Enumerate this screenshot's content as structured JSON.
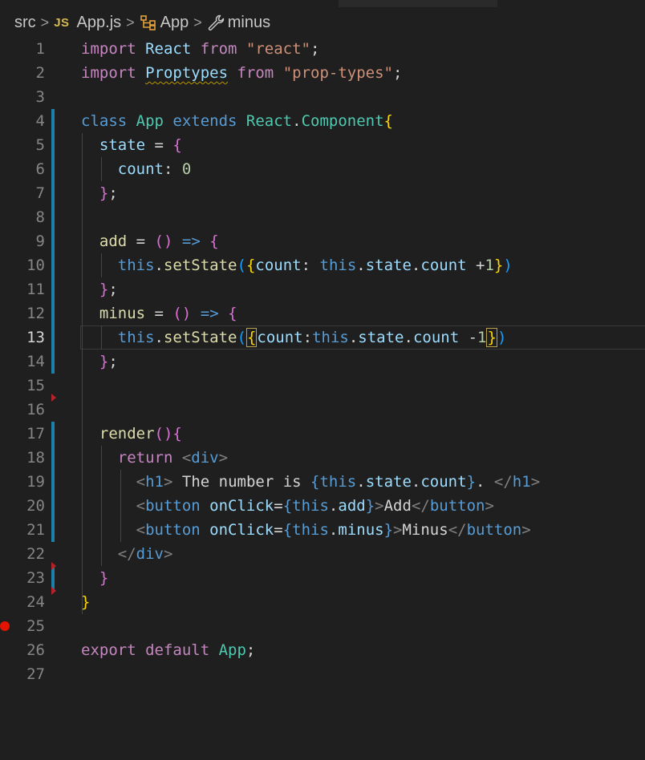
{
  "breadcrumb": {
    "folder": "src",
    "file_icon": "JS",
    "file": "App.js",
    "class_name": "App",
    "method_name": "minus"
  },
  "editor": {
    "active_line": 13,
    "line_numbers": [
      "1",
      "2",
      "3",
      "4",
      "5",
      "6",
      "7",
      "8",
      "9",
      "10",
      "11",
      "12",
      "13",
      "14",
      "15",
      "16",
      "17",
      "18",
      "19",
      "20",
      "21",
      "22",
      "23",
      "24",
      "25",
      "26",
      "27"
    ],
    "lines": [
      [
        [
          "kw",
          "import "
        ],
        [
          "var",
          "React "
        ],
        [
          "kw",
          "from "
        ],
        [
          "str",
          "\"react\""
        ],
        [
          "punc",
          ";"
        ]
      ],
      [
        [
          "kw",
          "import "
        ],
        [
          "var squiggle",
          "Proptypes"
        ],
        [
          "punc",
          " "
        ],
        [
          "kw",
          "from "
        ],
        [
          "str",
          "\"prop-types\""
        ],
        [
          "punc",
          ";"
        ]
      ],
      [],
      [
        [
          "kw2",
          "class "
        ],
        [
          "cls",
          "App "
        ],
        [
          "kw2",
          "extends "
        ],
        [
          "cls",
          "React"
        ],
        [
          "punc",
          "."
        ],
        [
          "cls",
          "Component"
        ],
        [
          "b1",
          "{"
        ]
      ],
      [
        [
          "punc",
          "  "
        ],
        [
          "var",
          "state "
        ],
        [
          "punc",
          "= "
        ],
        [
          "b2",
          "{"
        ]
      ],
      [
        [
          "punc",
          "    "
        ],
        [
          "var",
          "count"
        ],
        [
          "punc",
          ": "
        ],
        [
          "num",
          "0"
        ]
      ],
      [
        [
          "punc",
          "  "
        ],
        [
          "b2",
          "}"
        ],
        [
          "punc",
          ";"
        ]
      ],
      [],
      [
        [
          "punc",
          "  "
        ],
        [
          "fn",
          "add "
        ],
        [
          "punc",
          "= "
        ],
        [
          "b2",
          "()"
        ],
        [
          "punc",
          " "
        ],
        [
          "kw2",
          "=>"
        ],
        [
          "punc",
          " "
        ],
        [
          "b2",
          "{"
        ]
      ],
      [
        [
          "punc",
          "    "
        ],
        [
          "kw2",
          "this"
        ],
        [
          "punc",
          "."
        ],
        [
          "fn",
          "setState"
        ],
        [
          "b3",
          "("
        ],
        [
          "b1",
          "{"
        ],
        [
          "var",
          "count"
        ],
        [
          "punc",
          ": "
        ],
        [
          "kw2",
          "this"
        ],
        [
          "punc",
          "."
        ],
        [
          "var",
          "state"
        ],
        [
          "punc",
          "."
        ],
        [
          "var",
          "count "
        ],
        [
          "punc",
          "+"
        ],
        [
          "num",
          "1"
        ],
        [
          "b1",
          "}"
        ],
        [
          "b3",
          ")"
        ]
      ],
      [
        [
          "punc",
          "  "
        ],
        [
          "b2",
          "}"
        ],
        [
          "punc",
          ";"
        ]
      ],
      [
        [
          "punc",
          "  "
        ],
        [
          "fn",
          "minus "
        ],
        [
          "punc",
          "= "
        ],
        [
          "b2",
          "()"
        ],
        [
          "punc",
          " "
        ],
        [
          "kw2",
          "=>"
        ],
        [
          "punc",
          " "
        ],
        [
          "b2",
          "{"
        ]
      ],
      [
        [
          "punc",
          "    "
        ],
        [
          "kw2",
          "this"
        ],
        [
          "punc",
          "."
        ],
        [
          "fn",
          "setState"
        ],
        [
          "b3",
          "("
        ],
        [
          "b1 bracket-box",
          "{"
        ],
        [
          "var",
          "count"
        ],
        [
          "punc",
          ":"
        ],
        [
          "kw2",
          "this"
        ],
        [
          "punc",
          "."
        ],
        [
          "var",
          "state"
        ],
        [
          "punc",
          "."
        ],
        [
          "var",
          "count "
        ],
        [
          "punc",
          "-"
        ],
        [
          "num",
          "1"
        ],
        [
          "b1 bracket-box",
          "}"
        ],
        [
          "b3",
          ")"
        ]
      ],
      [
        [
          "punc",
          "  "
        ],
        [
          "b2",
          "}"
        ],
        [
          "punc",
          ";"
        ]
      ],
      [],
      [],
      [
        [
          "punc",
          "  "
        ],
        [
          "fn",
          "render"
        ],
        [
          "b2",
          "()"
        ],
        [
          "b2",
          "{"
        ]
      ],
      [
        [
          "punc",
          "    "
        ],
        [
          "kw",
          "return "
        ],
        [
          "tagp",
          "<"
        ],
        [
          "tag",
          "div"
        ],
        [
          "tagp",
          ">"
        ]
      ],
      [
        [
          "punc",
          "      "
        ],
        [
          "tagp",
          "<"
        ],
        [
          "tag",
          "h1"
        ],
        [
          "tagp",
          "> "
        ],
        [
          "txt",
          "The number is "
        ],
        [
          "kw2",
          "{"
        ],
        [
          "kw2",
          "this"
        ],
        [
          "punc",
          "."
        ],
        [
          "var",
          "state"
        ],
        [
          "punc",
          "."
        ],
        [
          "var",
          "count"
        ],
        [
          "kw2",
          "}"
        ],
        [
          "txt",
          ". "
        ],
        [
          "tagp",
          "</"
        ],
        [
          "tag",
          "h1"
        ],
        [
          "tagp",
          ">"
        ]
      ],
      [
        [
          "punc",
          "      "
        ],
        [
          "tagp",
          "<"
        ],
        [
          "tag",
          "button "
        ],
        [
          "attr",
          "onClick"
        ],
        [
          "punc",
          "="
        ],
        [
          "kw2",
          "{"
        ],
        [
          "kw2",
          "this"
        ],
        [
          "punc",
          "."
        ],
        [
          "var",
          "add"
        ],
        [
          "kw2",
          "}"
        ],
        [
          "tagp",
          ">"
        ],
        [
          "txt",
          "Add"
        ],
        [
          "tagp",
          "</"
        ],
        [
          "tag",
          "button"
        ],
        [
          "tagp",
          ">"
        ]
      ],
      [
        [
          "punc",
          "      "
        ],
        [
          "tagp",
          "<"
        ],
        [
          "tag",
          "button "
        ],
        [
          "attr",
          "onClick"
        ],
        [
          "punc",
          "="
        ],
        [
          "kw2",
          "{"
        ],
        [
          "kw2",
          "this"
        ],
        [
          "punc",
          "."
        ],
        [
          "var",
          "minus"
        ],
        [
          "kw2",
          "}"
        ],
        [
          "tagp",
          ">"
        ],
        [
          "txt",
          "Minus"
        ],
        [
          "tagp",
          "</"
        ],
        [
          "tag",
          "button"
        ],
        [
          "tagp",
          ">"
        ]
      ],
      [
        [
          "punc",
          "    "
        ],
        [
          "tagp",
          "</"
        ],
        [
          "tag",
          "div"
        ],
        [
          "tagp",
          ">"
        ]
      ],
      [
        [
          "punc",
          "  "
        ],
        [
          "b2",
          "}"
        ]
      ],
      [
        [
          "b1",
          "}"
        ]
      ],
      [],
      [
        [
          "kw",
          "export "
        ],
        [
          "kw",
          "default "
        ],
        [
          "cls",
          "App"
        ],
        [
          "punc",
          ";"
        ]
      ],
      []
    ]
  },
  "colors": {
    "background": "#1f1f1f",
    "line_number": "#858585",
    "scm_modified": "#1b81a8",
    "breakpoint": "#e51400"
  }
}
